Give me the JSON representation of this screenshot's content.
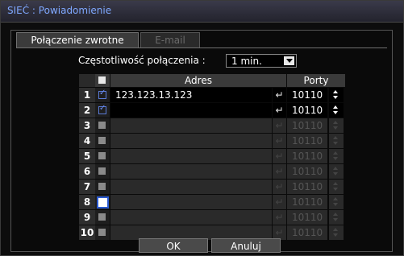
{
  "title": "SIEĆ : Powiadomienie",
  "tabs": [
    {
      "label": "Połączenie zwrotne",
      "active": true
    },
    {
      "label": "E-mail",
      "active": false
    }
  ],
  "frequency": {
    "label": "Częstotliwość połączenia :",
    "value": "1 min."
  },
  "table": {
    "headers": {
      "address": "Adres",
      "ports": "Porty"
    },
    "rows": [
      {
        "num": "1",
        "checked": true,
        "address": "123.123.13.123",
        "port": "10110",
        "enabled": true
      },
      {
        "num": "2",
        "checked": true,
        "address": "",
        "port": "10110",
        "enabled": true
      },
      {
        "num": "3",
        "checked": false,
        "address": "",
        "port": "10110",
        "enabled": false
      },
      {
        "num": "4",
        "checked": false,
        "address": "",
        "port": "10110",
        "enabled": false
      },
      {
        "num": "5",
        "checked": false,
        "address": "",
        "port": "10110",
        "enabled": false
      },
      {
        "num": "6",
        "checked": false,
        "address": "",
        "port": "10110",
        "enabled": false
      },
      {
        "num": "7",
        "checked": false,
        "address": "",
        "port": "10110",
        "enabled": false
      },
      {
        "num": "8",
        "checked": false,
        "address": "",
        "port": "10110",
        "enabled": false,
        "focused": true
      },
      {
        "num": "9",
        "checked": false,
        "address": "",
        "port": "10110",
        "enabled": false
      },
      {
        "num": "10",
        "checked": false,
        "address": "",
        "port": "10110",
        "enabled": false
      }
    ]
  },
  "buttons": {
    "ok": "OK",
    "cancel": "Anuluj"
  },
  "icons": {
    "enter": "enter-icon",
    "spin": "spinner-icon",
    "dropdown": "dropdown-arrow-icon",
    "checkbox": "checkbox-icon"
  }
}
